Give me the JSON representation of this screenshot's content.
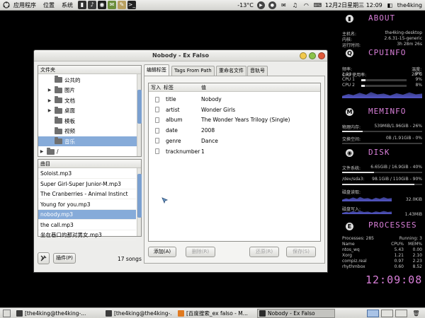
{
  "top_panel": {
    "menu": [
      "应用程序",
      "位置",
      "系统"
    ],
    "launchers": [
      {
        "icon": "terminal-icon",
        "glyph": "▮",
        "color": "#2f2f2f"
      },
      {
        "icon": "music-player-icon",
        "glyph": "♪",
        "color": "#3a3a3a"
      },
      {
        "icon": "browser-icon",
        "glyph": "◉",
        "color": "#1e1e1e"
      },
      {
        "icon": "chat-icon",
        "glyph": "✉",
        "color": "#6b8e3a"
      },
      {
        "icon": "text-editor-icon",
        "glyph": "✎",
        "color": "#b8a060"
      },
      {
        "icon": "console-icon",
        "glyph": ">_",
        "color": "#222"
      }
    ],
    "temperature": "-13°C",
    "clock": "12月2日星期三 12:09",
    "user": "the4king"
  },
  "window": {
    "title": "Nobody - Ex Falso",
    "folder_header": "文件夹",
    "folders": [
      {
        "label": "公共的",
        "expander": ""
      },
      {
        "label": "图片",
        "expander": "▶"
      },
      {
        "label": "文档",
        "expander": "▶"
      },
      {
        "label": "桌面",
        "expander": "▶"
      },
      {
        "label": "模板",
        "expander": ""
      },
      {
        "label": "视频",
        "expander": ""
      },
      {
        "label": "音乐",
        "expander": "",
        "selected": true
      },
      {
        "label": "/",
        "expander": "▶"
      }
    ],
    "songs_header": "曲目",
    "files": [
      {
        "name": "Soloist.mp3"
      },
      {
        "name": "Super Girl-Super Junior-M.mp3"
      },
      {
        "name": "The Cranberries - Animal Instinct"
      },
      {
        "name": "Young for you.mp3"
      },
      {
        "name": "nobody.mp3",
        "selected": true
      },
      {
        "name": "the call.mp3"
      },
      {
        "name": "坐在巷口的那对男女.mp3"
      }
    ],
    "plugins_button": "插件(P)",
    "song_count": "17 songs",
    "tabs": [
      {
        "label": "编辑标签",
        "active": true
      },
      {
        "label": "Tags From Path",
        "active": false
      },
      {
        "label": "重命名文件",
        "active": false
      },
      {
        "label": "音轨号",
        "active": false
      }
    ],
    "tag_columns": {
      "write": "写入",
      "tag": "标签",
      "value": "值"
    },
    "tags": [
      {
        "tag": "title",
        "value": "Nobody"
      },
      {
        "tag": "artist",
        "value": "Wonder Girls"
      },
      {
        "tag": "album",
        "value": "The Wonder Years Trilogy (Single)"
      },
      {
        "tag": "date",
        "value": "2008"
      },
      {
        "tag": "genre",
        "value": "Dance"
      },
      {
        "tag": "tracknumber",
        "value": "1"
      }
    ],
    "buttons": {
      "add": "添加(A)",
      "remove": "删除(R)",
      "revert": "还原(R)",
      "save": "保存(S)"
    }
  },
  "conky": {
    "about": {
      "heading": "ABOUT",
      "rows": [
        {
          "label": "主机名:",
          "value": "the4king-desktop"
        },
        {
          "label": "内核:",
          "value": "2.6.31-15-generic"
        },
        {
          "label": "运行时间:",
          "value": "3h 28m 26s"
        }
      ]
    },
    "cpu": {
      "heading": "CPUINFO",
      "freq_label": "频率:",
      "freq": "1.20",
      "temp_label": "温度:",
      "temp": "28°C",
      "rows": [
        {
          "label": "CPU 使用率:",
          "value": "9%"
        },
        {
          "label": "CPU 1",
          "value": "9%",
          "level": 0.09
        },
        {
          "label": "CPU 2",
          "value": "8%",
          "level": 0.08
        }
      ]
    },
    "mem": {
      "heading": "MEMINFO",
      "rows": [
        {
          "label": "物理内存:",
          "value": "539MiB/1.96GiB - 26%",
          "level": 0.26
        },
        {
          "label": "交换空间:",
          "value": "0B /1.91GiB - 0%",
          "level": 0.0
        }
      ]
    },
    "disk": {
      "heading": "DISK",
      "rows": [
        {
          "label": "文件系统:",
          "value": "6.65GiB / 16.9GiB - 40%",
          "level": 0.4
        },
        {
          "label": "/dev/sda3:",
          "value": "98.1GiB / 110GiB - 90%",
          "level": 0.9
        }
      ],
      "read_label": "磁盘读取:",
      "read_value": "32.0KiB",
      "write_label": "磁盘写入:",
      "write_value": "1.43MiB"
    },
    "processes": {
      "heading": "PROCESSES",
      "summary_left": "Processes: 285",
      "summary_right": "Running: 3",
      "columns": {
        "name": "Name",
        "cpu": "CPU%",
        "mem": "MEM%"
      },
      "rows": [
        {
          "name": "ntos_wq",
          "cpu": "5.43",
          "mem": "0.00"
        },
        {
          "name": "Xorg",
          "cpu": "1.21",
          "mem": "2.10"
        },
        {
          "name": "compiz.real",
          "cpu": "0.97",
          "mem": "2.23"
        },
        {
          "name": "rhythmbox",
          "cpu": "0.60",
          "mem": "8.52"
        }
      ]
    },
    "time": "12:09:08"
  },
  "taskbar": {
    "tasks": [
      {
        "label": "[the4king@the4king-...",
        "icon_color": "#3c3c3c",
        "active": false
      },
      {
        "label": "[the4king@the4king-...",
        "icon_color": "#3c3c3c",
        "active": false
      },
      {
        "label": "[百度搜索_ex falso - M...",
        "icon_color": "#e07a20",
        "active": false
      },
      {
        "label": "Nobody - Ex Falso",
        "icon_color": "#2a2a2a",
        "active": true
      }
    ]
  }
}
